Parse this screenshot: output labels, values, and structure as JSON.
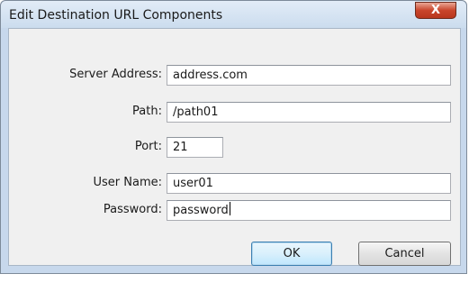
{
  "window": {
    "title": "Edit Destination URL Components",
    "close_glyph": "X"
  },
  "form": {
    "fields": [
      {
        "label": "Server Address:",
        "value": "address.com"
      },
      {
        "label": "Path:",
        "value": "/path01"
      },
      {
        "label": "Port:",
        "value": "21"
      },
      {
        "label": "User Name:",
        "value": "user01"
      },
      {
        "label": "Password:",
        "value": "password"
      }
    ]
  },
  "buttons": {
    "ok_label": "OK",
    "cancel_label": "Cancel"
  },
  "icons": {
    "close": "close-icon"
  }
}
